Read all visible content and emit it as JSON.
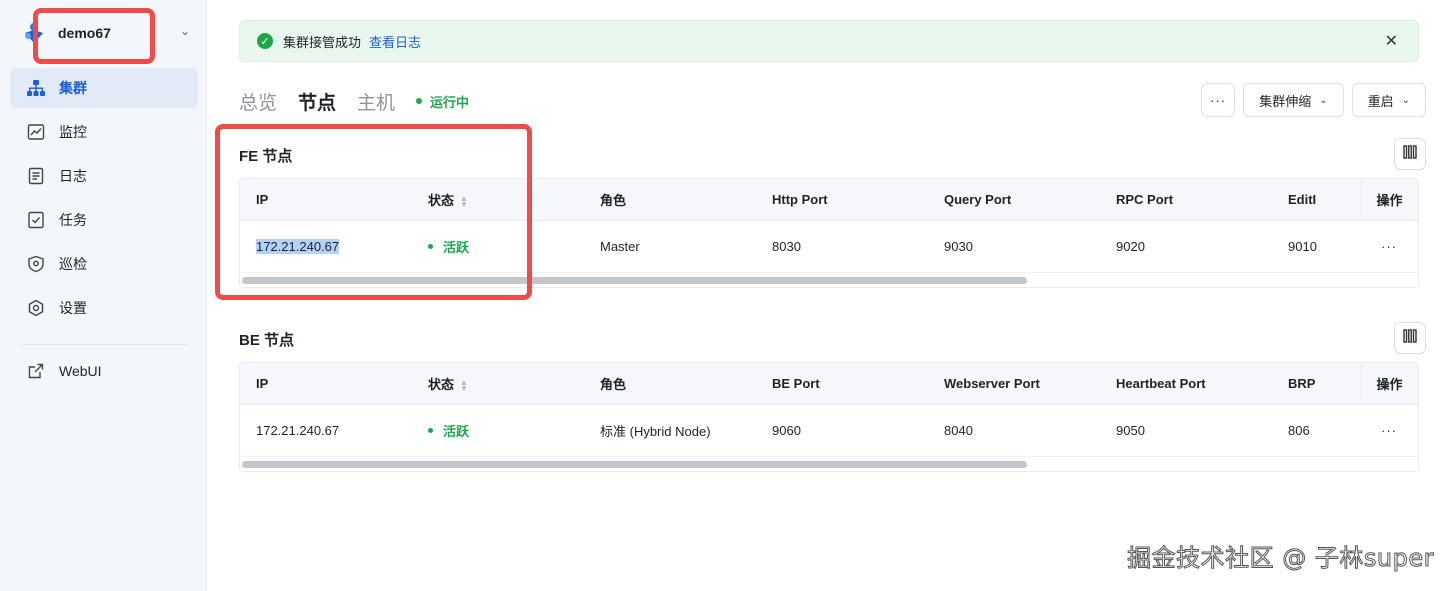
{
  "sidebar": {
    "cluster_name": "demo67",
    "nav": [
      {
        "label": "集群",
        "icon": "cluster-icon",
        "active": true
      },
      {
        "label": "监控",
        "icon": "monitor-chart-icon",
        "active": false
      },
      {
        "label": "日志",
        "icon": "log-document-icon",
        "active": false
      },
      {
        "label": "任务",
        "icon": "task-icon",
        "active": false
      },
      {
        "label": "巡检",
        "icon": "shield-icon",
        "active": false
      },
      {
        "label": "设置",
        "icon": "gear-icon",
        "active": false
      }
    ],
    "webui_label": "WebUI"
  },
  "alert": {
    "message": "集群接管成功",
    "link": "查看日志"
  },
  "tabs": [
    {
      "label": "总览",
      "active": false
    },
    {
      "label": "节点",
      "active": true
    },
    {
      "label": "主机",
      "active": false
    }
  ],
  "status": "运行中",
  "actions": {
    "more": "···",
    "scale": "集群伸缩",
    "restart": "重启"
  },
  "fe": {
    "title": "FE 节点",
    "columns": [
      "IP",
      "状态",
      "角色",
      "Http Port",
      "Query Port",
      "RPC Port",
      "EditI",
      "操作"
    ],
    "rows": [
      {
        "ip": "172.21.240.67",
        "status": "活跃",
        "role": "Master",
        "port1": "8030",
        "port2": "9030",
        "port3": "9020",
        "port4": "9010",
        "op": "···"
      }
    ]
  },
  "be": {
    "title": "BE 节点",
    "columns": [
      "IP",
      "状态",
      "角色",
      "BE Port",
      "Webserver Port",
      "Heartbeat Port",
      "BRP",
      "操作"
    ],
    "rows": [
      {
        "ip": "172.21.240.67",
        "status": "活跃",
        "role": "标准 (Hybrid Node)",
        "port1": "9060",
        "port2": "8040",
        "port3": "9050",
        "port4": "806",
        "op": "···"
      }
    ]
  },
  "watermark": "掘金技术社区 @ 子林super",
  "colors": {
    "accent": "#1a5fd6",
    "success": "#1fa64b",
    "highlight_box": "#ef4b4b"
  }
}
